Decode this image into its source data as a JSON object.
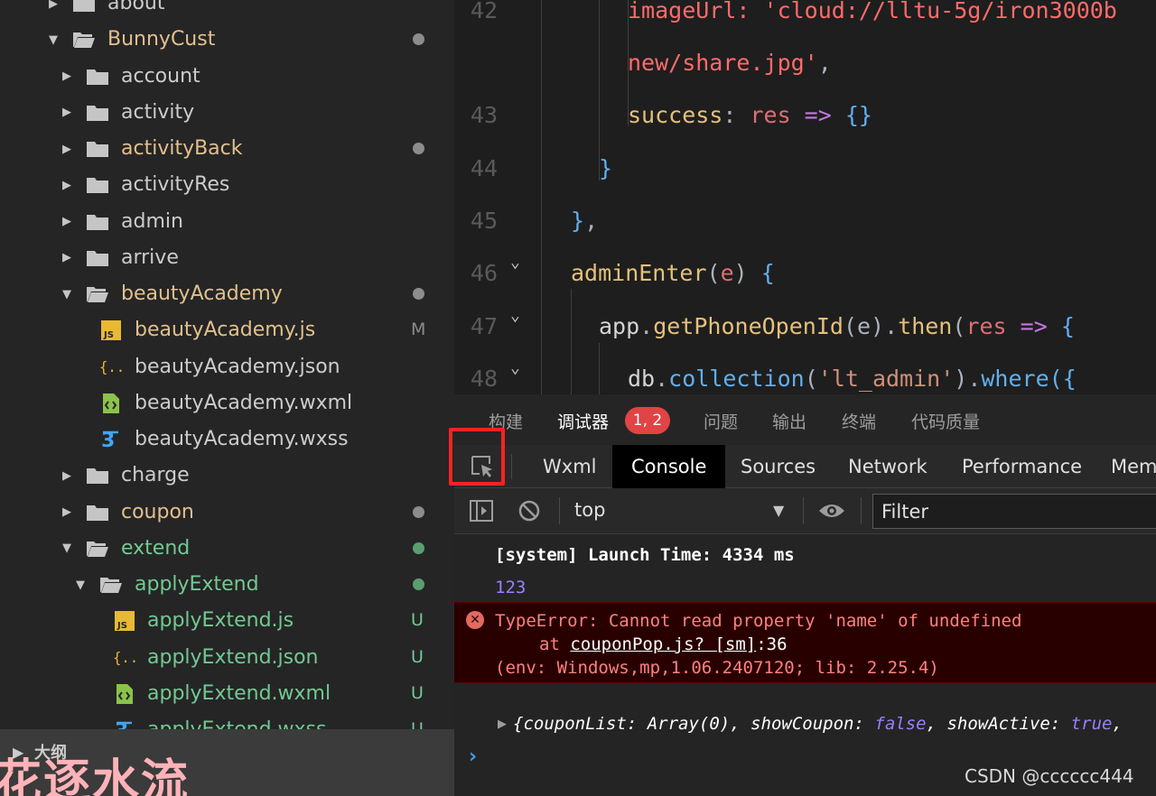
{
  "explorer": {
    "items": [
      {
        "label": "about",
        "color": "white",
        "kind": "folder",
        "state": "collapsed",
        "depth": 0,
        "status": ""
      },
      {
        "label": "BunnyCust",
        "color": "yellow",
        "kind": "folder",
        "state": "expanded",
        "depth": 0,
        "status": "dot"
      },
      {
        "label": "account",
        "color": "white",
        "kind": "folder",
        "state": "collapsed",
        "depth": 1,
        "status": ""
      },
      {
        "label": "activity",
        "color": "white",
        "kind": "folder",
        "state": "collapsed",
        "depth": 1,
        "status": ""
      },
      {
        "label": "activityBack",
        "color": "yellow",
        "kind": "folder",
        "state": "collapsed",
        "depth": 1,
        "status": "dot"
      },
      {
        "label": "activityRes",
        "color": "white",
        "kind": "folder",
        "state": "collapsed",
        "depth": 1,
        "status": ""
      },
      {
        "label": "admin",
        "color": "white",
        "kind": "folder",
        "state": "collapsed",
        "depth": 1,
        "status": ""
      },
      {
        "label": "arrive",
        "color": "white",
        "kind": "folder",
        "state": "collapsed",
        "depth": 1,
        "status": ""
      },
      {
        "label": "beautyAcademy",
        "color": "yellow",
        "kind": "folder",
        "state": "expanded",
        "depth": 1,
        "status": "dot"
      },
      {
        "label": "beautyAcademy.js",
        "color": "yellow",
        "kind": "js",
        "depth": 2,
        "status": "M"
      },
      {
        "label": "beautyAcademy.json",
        "color": "white",
        "kind": "json",
        "depth": 2,
        "status": ""
      },
      {
        "label": "beautyAcademy.wxml",
        "color": "white",
        "kind": "wxml",
        "depth": 2,
        "status": ""
      },
      {
        "label": "beautyAcademy.wxss",
        "color": "white",
        "kind": "wxss",
        "depth": 2,
        "status": ""
      },
      {
        "label": "charge",
        "color": "white",
        "kind": "folder",
        "state": "collapsed",
        "depth": 1,
        "status": ""
      },
      {
        "label": "coupon",
        "color": "yellow",
        "kind": "folder",
        "state": "collapsed",
        "depth": 1,
        "status": "dot"
      },
      {
        "label": "extend",
        "color": "green",
        "kind": "folder",
        "state": "expanded",
        "depth": 1,
        "status": "dot-green"
      },
      {
        "label": "applyExtend",
        "color": "green",
        "kind": "folder",
        "state": "expanded",
        "depth": 2,
        "status": "dot-green"
      },
      {
        "label": "applyExtend.js",
        "color": "green",
        "kind": "js",
        "depth": 3,
        "status": "U"
      },
      {
        "label": "applyExtend.json",
        "color": "green",
        "kind": "json",
        "depth": 3,
        "status": "U"
      },
      {
        "label": "applyExtend.wxml",
        "color": "green",
        "kind": "wxml",
        "depth": 3,
        "status": "U"
      },
      {
        "label": "applyExtend.wxss",
        "color": "green",
        "kind": "wxss",
        "depth": 3,
        "status": "U"
      }
    ],
    "outline_label": "大纲",
    "watermark": "花逐水流"
  },
  "colors": {
    "white": "#cccccc",
    "yellow": "#e2c08d",
    "green": "#73c991",
    "error_bg": "#290000",
    "error_text": "#ff8080",
    "highlight": "#ff2222"
  },
  "editor": {
    "lines": [
      {
        "num": "42",
        "fold": false,
        "segments": [
          {
            "t": "imageUrl: 'cloud://lltu-5g/iron3000b",
            "c": "t-strr"
          }
        ]
      },
      {
        "num": "",
        "fold": false,
        "segments": [
          {
            "t": "new/share.jpg'",
            "c": "t-strr"
          },
          {
            "t": ",",
            "c": "t-pun"
          }
        ]
      },
      {
        "num": "43",
        "fold": false,
        "segments": [
          {
            "t": "success",
            "c": "t-key"
          },
          {
            "t": ": ",
            "c": "t-pun"
          },
          {
            "t": "res",
            "c": "t-var"
          },
          {
            "t": " => ",
            "c": "t-arr"
          },
          {
            "t": "{}",
            "c": "t-brc"
          }
        ]
      },
      {
        "num": "44",
        "fold": false,
        "segments": [
          {
            "t": "}",
            "c": "t-brc"
          }
        ]
      },
      {
        "num": "45",
        "fold": false,
        "segments": [
          {
            "t": "}",
            "c": "t-brc"
          },
          {
            "t": ",",
            "c": "t-pun"
          }
        ]
      },
      {
        "num": "46",
        "fold": true,
        "segments": [
          {
            "t": "adminEnter",
            "c": "t-fn"
          },
          {
            "t": "(",
            "c": "t-pun"
          },
          {
            "t": "e",
            "c": "t-var"
          },
          {
            "t": ") ",
            "c": "t-pun"
          },
          {
            "t": "{",
            "c": "t-brc"
          }
        ]
      },
      {
        "num": "47",
        "fold": true,
        "segments": [
          {
            "t": "app",
            "c": "t-id"
          },
          {
            "t": ".",
            "c": "t-pun"
          },
          {
            "t": "getPhoneOpenId",
            "c": "t-fn"
          },
          {
            "t": "(e).",
            "c": "t-pun"
          },
          {
            "t": "then",
            "c": "t-fn"
          },
          {
            "t": "(",
            "c": "t-pun"
          },
          {
            "t": "res",
            "c": "t-var"
          },
          {
            "t": " => ",
            "c": "t-arr"
          },
          {
            "t": "{",
            "c": "t-brc"
          }
        ]
      },
      {
        "num": "48",
        "fold": true,
        "segments": [
          {
            "t": "db",
            "c": "t-id"
          },
          {
            "t": ".",
            "c": "t-pun"
          },
          {
            "t": "collection",
            "c": "t-meth"
          },
          {
            "t": "(",
            "c": "t-pun"
          },
          {
            "t": "'lt_admin'",
            "c": "t-str"
          },
          {
            "t": ").",
            "c": "t-pun"
          },
          {
            "t": "where",
            "c": "t-meth"
          },
          {
            "t": "({",
            "c": "t-brc"
          }
        ]
      }
    ]
  },
  "panel_tabs": {
    "items": [
      "构建",
      "调试器",
      "问题",
      "输出",
      "终端",
      "代码质量"
    ],
    "active": "调试器",
    "error_badge": "1, 2"
  },
  "devtools": {
    "tabs": [
      "Wxml",
      "Console",
      "Sources",
      "Network",
      "Performance",
      "Mem"
    ],
    "active": "Console",
    "context": "top",
    "filter_placeholder": "Filter"
  },
  "console": {
    "system_line": "[system] Launch Time: 4334 ms",
    "log_line": "123",
    "error": {
      "message": "TypeError: Cannot read property 'name' of undefined",
      "at_prefix": "at ",
      "at_link": "couponPop.js? [sm]",
      "at_suffix": ":36",
      "env": "(env: Windows,mp,1.06.2407120; lib: 2.25.4)"
    },
    "object_line": {
      "p1": "{couponList: Array(0), showCoupon: ",
      "v1": "false",
      "p2": ", showActive: ",
      "v2": "true",
      "p3": ","
    }
  },
  "watermark_csdn": "CSDN @cccccc444"
}
